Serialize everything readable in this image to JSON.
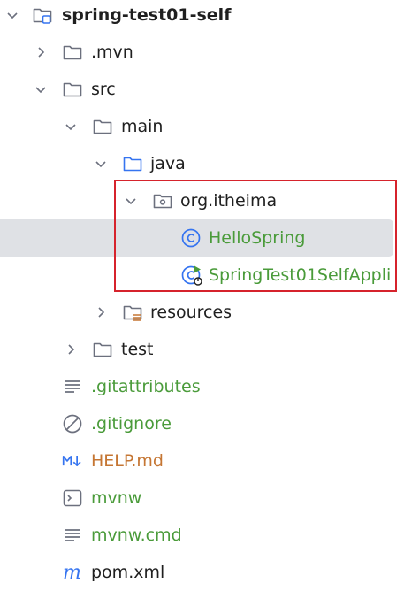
{
  "tree": {
    "root": {
      "label": "spring-test01-self"
    },
    "mvn": {
      "label": ".mvn"
    },
    "src": {
      "label": "src"
    },
    "main": {
      "label": "main"
    },
    "java": {
      "label": "java"
    },
    "package": {
      "label": "org.itheima"
    },
    "hello_spring": {
      "label": "HelloSpring"
    },
    "app_class": {
      "label": "SpringTest01SelfAppli"
    },
    "resources": {
      "label": "resources"
    },
    "test": {
      "label": "test"
    },
    "gitattributes": {
      "label": ".gitattributes"
    },
    "gitignore": {
      "label": ".gitignore"
    },
    "help_md": {
      "label": "HELP.md"
    },
    "mvnw": {
      "label": "mvnw"
    },
    "mvnw_cmd": {
      "label": "mvnw.cmd"
    },
    "pom": {
      "label": "pom.xml"
    }
  },
  "colors": {
    "vcs_added": "#4a9b3a",
    "vcs_unversioned": "#c57633",
    "class_icon": "#3574f0",
    "selection": "#dfe1e5",
    "annotation_box": "#d6232c"
  },
  "icons": {
    "expanded": "chevron-down-icon",
    "collapsed": "chevron-right-icon",
    "folder": "folder-icon",
    "source_folder": "source-folder-icon",
    "package": "package-icon",
    "class": "class-icon",
    "spring_boot_app": "spring-boot-app-icon",
    "text_file": "text-file-icon",
    "ignore_file": "ignore-file-icon",
    "markdown": "markdown-icon",
    "shell_script": "terminal-icon",
    "maven": "maven-icon"
  }
}
